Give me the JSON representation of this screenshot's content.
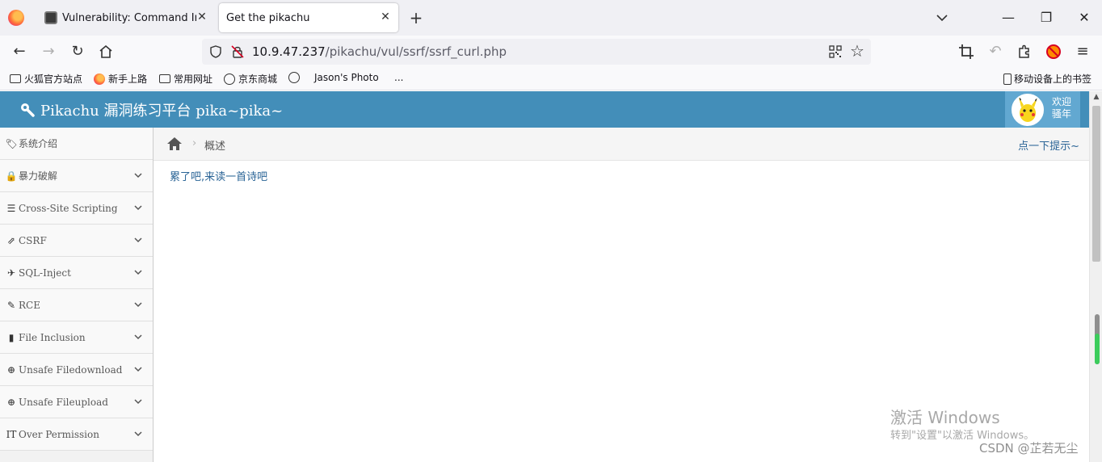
{
  "browser": {
    "tabs": [
      {
        "title": "Vulnerability: Command Injec",
        "active": false
      },
      {
        "title": "Get the pikachu",
        "active": true
      }
    ],
    "new_tab_symbol": "+",
    "close_symbol": "✕",
    "window_controls": {
      "minimize": "—",
      "restore": "❐",
      "close": "✕"
    },
    "url": {
      "host": "10.9.47.237",
      "path": "/pikachu/vul/ssrf/ssrf_curl.php"
    },
    "bookmarks": [
      {
        "label": "火狐官方站点",
        "icon": "folder-icon"
      },
      {
        "label": "新手上路",
        "icon": "firefox-icon"
      },
      {
        "label": "常用网址",
        "icon": "folder-icon"
      },
      {
        "label": "京东商城",
        "icon": "globe-icon"
      },
      {
        "label": "Jason's Photo",
        "icon": "globe-icon"
      },
      {
        "label": "...",
        "icon": ""
      }
    ],
    "mobile_bookmarks": "移动设备上的书签"
  },
  "app": {
    "brand": "Pikachu 漏洞练习平台 pika~pika~",
    "welcome": [
      "欢迎",
      "骚年"
    ],
    "header_color": "#438eb9"
  },
  "sidebar": {
    "items": [
      {
        "label": "系统介绍",
        "icon": "tags-icon",
        "glyph": "🏷",
        "expandable": false
      },
      {
        "label": "暴力破解",
        "icon": "lock-icon",
        "glyph": "🔒",
        "expandable": true
      },
      {
        "label": "Cross-Site Scripting",
        "icon": "list-icon",
        "glyph": "☰",
        "expandable": true
      },
      {
        "label": "CSRF",
        "icon": "share-icon",
        "glyph": "⇗",
        "expandable": true
      },
      {
        "label": "SQL-Inject",
        "icon": "plane-icon",
        "glyph": "✈",
        "expandable": true
      },
      {
        "label": "RCE",
        "icon": "pencil-icon",
        "glyph": "✎",
        "expandable": true
      },
      {
        "label": "File Inclusion",
        "icon": "file-icon",
        "glyph": "▮",
        "expandable": true
      },
      {
        "label": "Unsafe Filedownload",
        "icon": "download-icon",
        "glyph": "⊕",
        "expandable": true
      },
      {
        "label": "Unsafe Fileupload",
        "icon": "upload-icon",
        "glyph": "⊕",
        "expandable": true
      },
      {
        "label": "Over Permission",
        "icon": "text-height-icon",
        "glyph": "IT",
        "expandable": true
      }
    ]
  },
  "breadcrumb": {
    "separator": "›",
    "current": "概述"
  },
  "hint_link": "点一下提示~",
  "poem_link": "累了吧,来读一首诗吧",
  "overlay": {
    "activate_title": "激活 Windows",
    "activate_sub": "转到\"设置\"以激活 Windows。",
    "csdn": "CSDN @芷若无尘"
  }
}
